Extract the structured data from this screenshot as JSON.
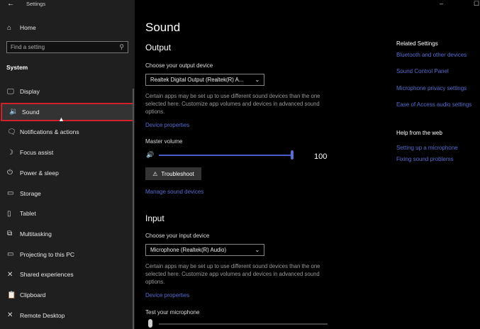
{
  "window": {
    "title": "Settings",
    "back_icon": "back-arrow-icon",
    "minimize": "–",
    "maximize": "☐"
  },
  "sidebar": {
    "home": "Home",
    "search_placeholder": "Find a setting",
    "section": "System",
    "items": [
      {
        "label": "Display",
        "icon": "🖵"
      },
      {
        "label": "Sound",
        "icon": "🔉"
      },
      {
        "label": "Notifications & actions",
        "icon": "🗨"
      },
      {
        "label": "Focus assist",
        "icon": "☽"
      },
      {
        "label": "Power & sleep",
        "icon": "⏻"
      },
      {
        "label": "Storage",
        "icon": "▭"
      },
      {
        "label": "Tablet",
        "icon": "▯"
      },
      {
        "label": "Multitasking",
        "icon": "⧉"
      },
      {
        "label": "Projecting to this PC",
        "icon": "▭"
      },
      {
        "label": "Shared experiences",
        "icon": "✕"
      },
      {
        "label": "Clipboard",
        "icon": "📋"
      },
      {
        "label": "Remote Desktop",
        "icon": "✕"
      }
    ],
    "selected": "Sound",
    "highlight_color": "#d0202a"
  },
  "main": {
    "title": "Sound",
    "output": {
      "heading": "Output",
      "device_label": "Choose your output device",
      "device_value": "Realtek Digital Output (Realtek(R) A...",
      "desc": "Certain apps may be set up to use different sound devices than the one selected here. Customize app volumes and devices in advanced sound options.",
      "properties": "Device properties",
      "volume_label": "Master volume",
      "volume": 100,
      "volume_text": "100",
      "troubleshoot": "Troubleshoot",
      "manage": "Manage sound devices"
    },
    "input": {
      "heading": "Input",
      "device_label": "Choose your input device",
      "device_value": "Microphone (Realtek(R) Audio)",
      "desc": "Certain apps may be set up to use different sound devices than the one selected here. Customize app volumes and devices in advanced sound options.",
      "properties": "Device properties",
      "test_label": "Test your microphone"
    }
  },
  "related": {
    "heading": "Related Settings",
    "links": [
      "Bluetooth and other devices",
      "Sound Control Panel",
      "Microphone privacy settings",
      "Ease of Access audio settings"
    ],
    "help_heading": "Help from the web",
    "help_links": [
      "Setting up a microphone",
      "Fixing sound problems"
    ]
  },
  "accent": "#5a6cd0"
}
